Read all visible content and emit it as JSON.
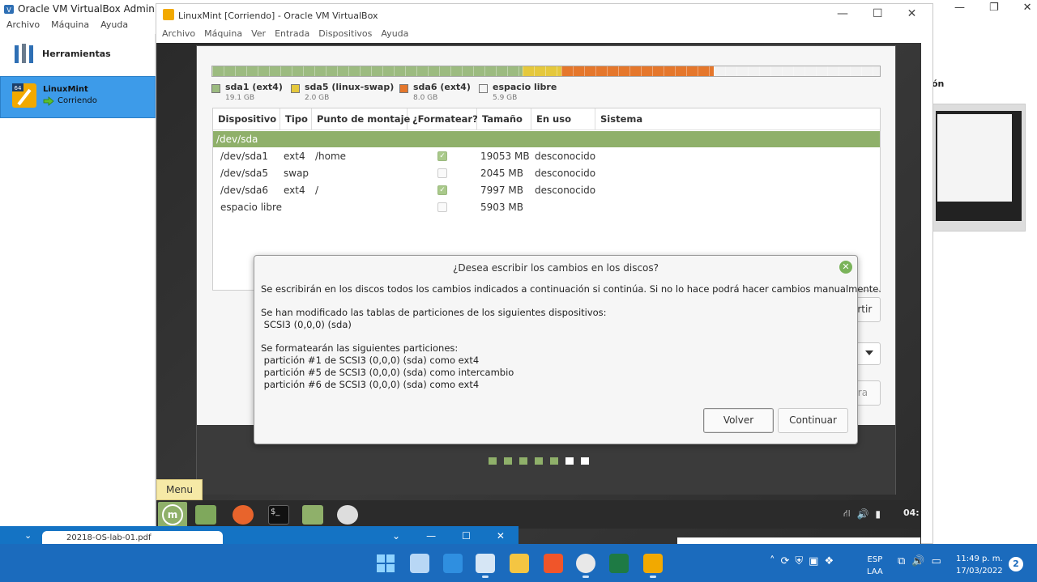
{
  "manager": {
    "title": "Oracle VM VirtualBox Administrador",
    "menu": [
      "Archivo",
      "Máquina",
      "Ayuda"
    ],
    "tools_label": "Herramientas",
    "vm_name": "LinuxMint",
    "vm_state": "Corriendo",
    "right_label_partial": "ón"
  },
  "vm_window": {
    "title": "LinuxMint [Corriendo] - Oracle VM VirtualBox",
    "menu": [
      "Archivo",
      "Máquina",
      "Ver",
      "Entrada",
      "Dispositivos",
      "Ayuda"
    ]
  },
  "installer": {
    "partition_bar": [
      {
        "name": "sda1 (ext4)",
        "size": "19.1 GB",
        "color": "#9cbb80",
        "fraction": 0.465
      },
      {
        "name": "sda5 (linux-swap)",
        "size": "2.0 GB",
        "color": "#e5c83c",
        "fraction": 0.058
      },
      {
        "name": "sda6 (ext4)",
        "size": "8.0 GB",
        "color": "#e5772c",
        "fraction": 0.228
      },
      {
        "name": "espacio libre",
        "size": "5.9 GB",
        "color": "#f2f2f2",
        "fraction": 0.249
      }
    ],
    "columns": [
      "Dispositivo",
      "Tipo",
      "Punto de montaje",
      "¿Formatear?",
      "Tamaño",
      "En uso",
      "Sistema"
    ],
    "disk_row": "/dev/sda",
    "rows": [
      {
        "device": "/dev/sda1",
        "type": "ext4",
        "mount": "/home",
        "format": true,
        "size": "19053 MB",
        "used": "desconocido"
      },
      {
        "device": "/dev/sda5",
        "type": "swap",
        "mount": "",
        "format": false,
        "size": "2045 MB",
        "used": "desconocido"
      },
      {
        "device": "/dev/sda6",
        "type": "ext4",
        "mount": "/",
        "format": true,
        "size": "7997 MB",
        "used": "desconocido"
      },
      {
        "device": "espacio libre",
        "type": "",
        "mount": "",
        "format": false,
        "size": "5903 MB",
        "used": ""
      }
    ],
    "revert_button": "Revertir",
    "install_button_partial": "talar ahora",
    "progress_dots": {
      "total": 7,
      "filled": 5
    }
  },
  "dialog": {
    "title": "¿Desea escribir los cambios en los discos?",
    "line1": "Se escribirán en los discos todos los cambios indicados a continuación si continúa. Si no lo hace podrá hacer cambios manualmente.",
    "line2": "Se han modificado las tablas de particiones de los siguientes dispositivos:",
    "line3": " SCSI3 (0,0,0) (sda)",
    "line4": "Se formatearán las siguientes particiones:",
    "line5": " partición #1 de SCSI3 (0,0,0) (sda) como ext4",
    "line6": " partición #5 de SCSI3 (0,0,0) (sda) como intercambio",
    "line7": " partición #6 de SCSI3 (0,0,0) (sda) como ext4",
    "back_button": "Volver",
    "continue_button": "Continuar"
  },
  "guest_panel": {
    "menu_tooltip": "Menu",
    "clock_partial": "04:"
  },
  "minimized_bar": {
    "tab_text": "20218-OS-lab-01.pdf"
  },
  "taskbar": {
    "lang_top": "ESP",
    "lang_bottom": "LAA",
    "time": "11:49 p. m.",
    "date": "17/03/2022",
    "notifications": "2"
  }
}
